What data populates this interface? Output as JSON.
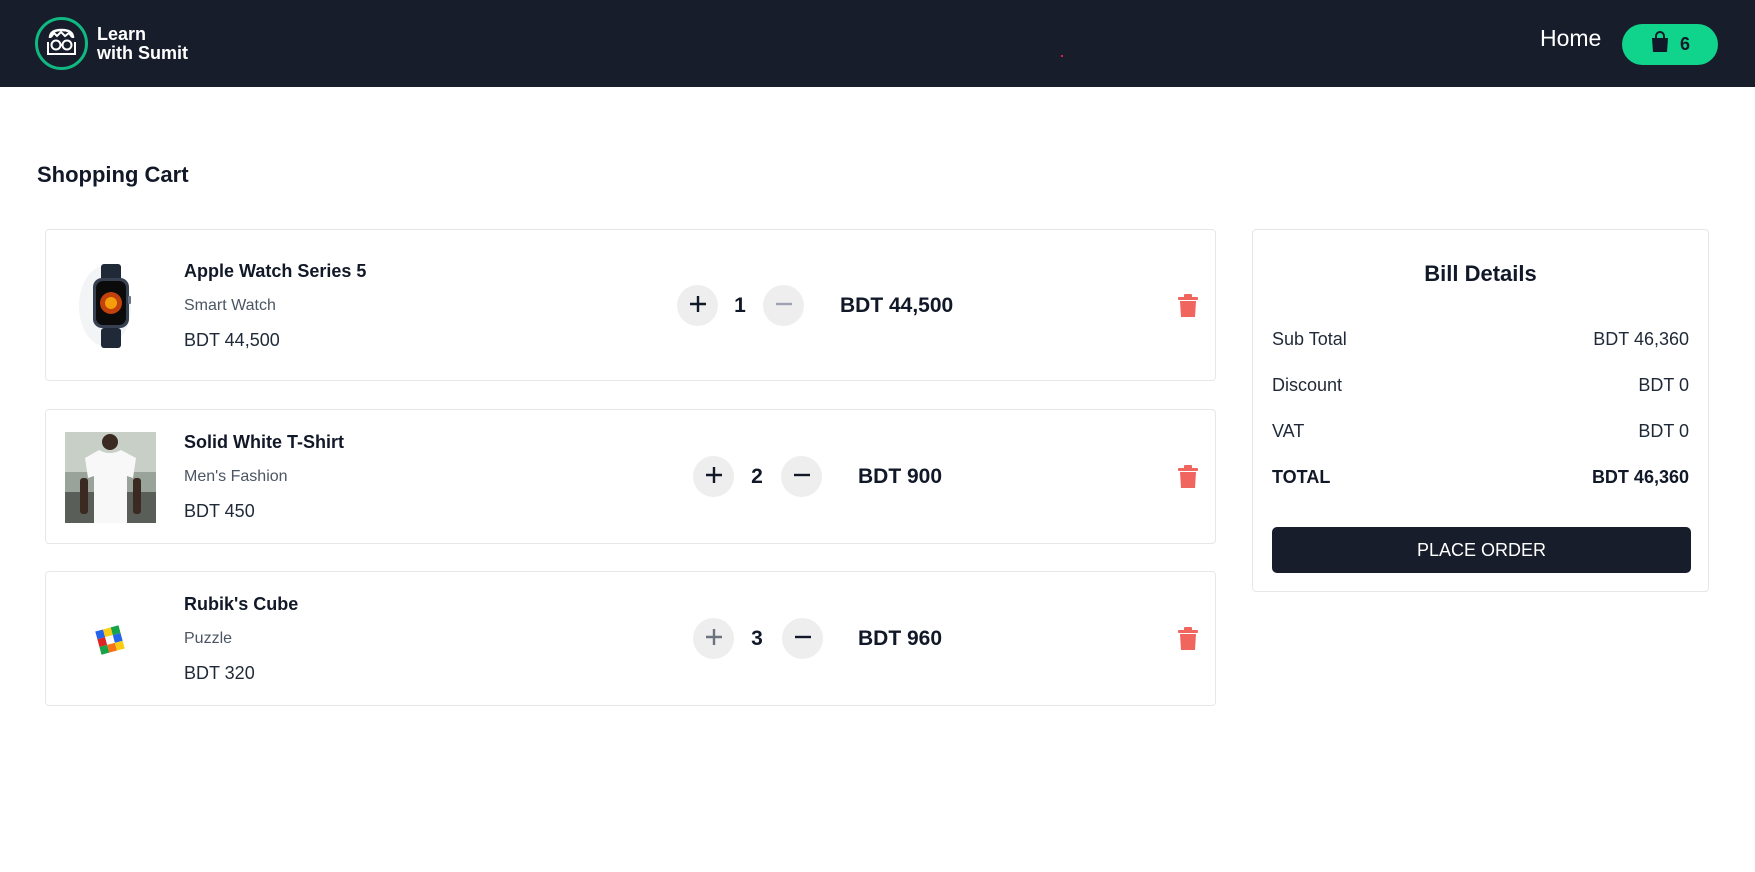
{
  "navbar": {
    "logo_line1": "Learn",
    "logo_line2": "with Sumit",
    "home_link": "Home",
    "cart_count": "6",
    "brand_color": "#10d48b",
    "bg_color": "#171d2b"
  },
  "page": {
    "title": "Shopping Cart"
  },
  "cart": {
    "items": [
      {
        "name": "Apple Watch Series 5",
        "category": "Smart Watch",
        "unit_price": "BDT 44,500",
        "quantity": "1",
        "line_total": "BDT 44,500",
        "image": "watch-image"
      },
      {
        "name": "Solid White T-Shirt",
        "category": "Men's Fashion",
        "unit_price": "BDT 450",
        "quantity": "2",
        "line_total": "BDT 900",
        "image": "tshirt-image"
      },
      {
        "name": "Rubik's Cube",
        "category": "Puzzle",
        "unit_price": "BDT 320",
        "quantity": "3",
        "line_total": "BDT 960",
        "image": "rubiks-cube-image"
      }
    ],
    "icons": {
      "increase": "plus-icon",
      "decrease": "minus-icon",
      "remove": "trash-icon"
    },
    "delete_color": "#f0665f"
  },
  "bill": {
    "title": "Bill Details",
    "subtotal_label": "Sub Total",
    "subtotal_value": "BDT 46,360",
    "discount_label": "Discount",
    "discount_value": "BDT 0",
    "vat_label": "VAT",
    "vat_value": "BDT 0",
    "total_label": "TOTAL",
    "total_value": "BDT 46,360",
    "place_order_label": "PLACE ORDER"
  }
}
